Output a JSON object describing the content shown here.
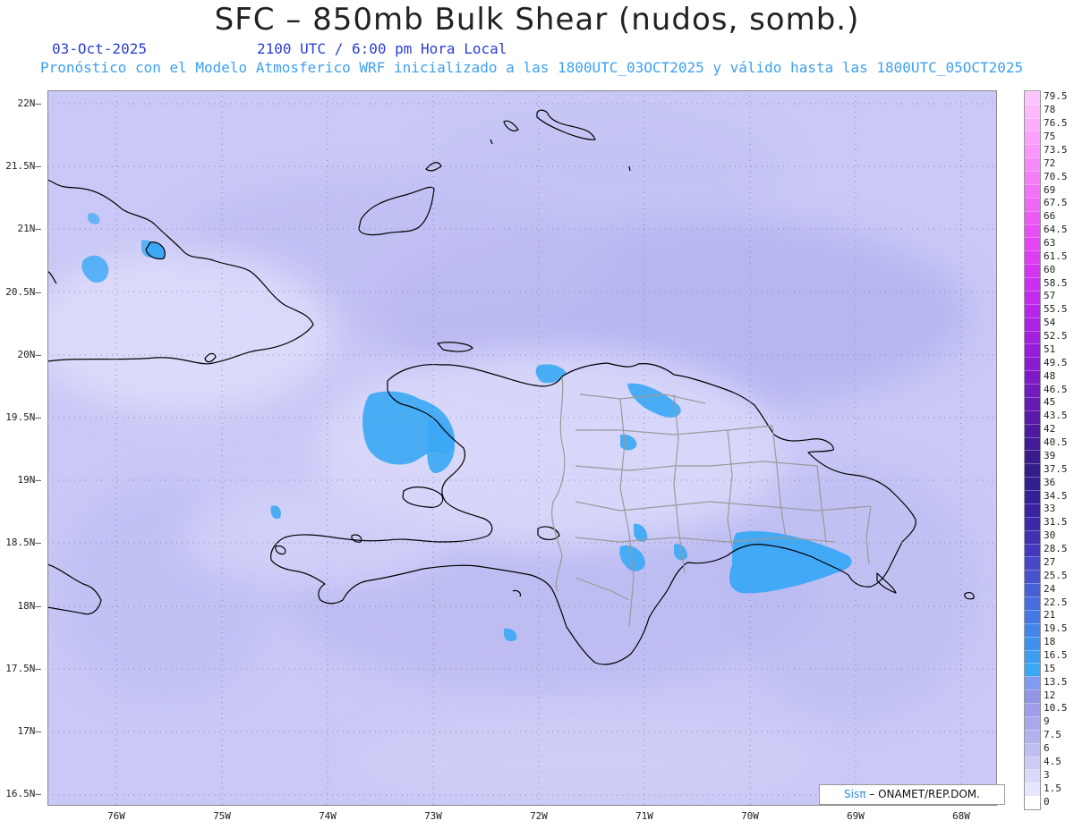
{
  "header": {
    "title": "SFC – 850mb Bulk Shear (nudos, somb.)",
    "date": "03-Oct-2025",
    "time": "2100 UTC / 6:00 pm Hora Local",
    "description": "Pronóstico con el Modelo Atmosferico WRF inicializado a las 1800UTC_03OCT2025 y válido hasta las  1800UTC_05OCT2025"
  },
  "map": {
    "lat_labels": [
      "22N",
      "21.5N",
      "21N",
      "20.5N",
      "20N",
      "19.5N",
      "19N",
      "18.5N",
      "18N",
      "17.5N",
      "17N",
      "16.5N"
    ],
    "lon_labels": [
      "76W",
      "75W",
      "74W",
      "73W",
      "72W",
      "71W",
      "70W",
      "69W",
      "68W"
    ],
    "base_color": "#c9c8f6",
    "coast_color": "#000000",
    "border_color": "#9a9a9a"
  },
  "colorbar": {
    "labels": [
      "0",
      "1.5",
      "3",
      "4.5",
      "6",
      "7.5",
      "9",
      "10.5",
      "12",
      "13.5",
      "15",
      "16.5",
      "18",
      "19.5",
      "21",
      "22.5",
      "24",
      "25.5",
      "27",
      "28.5",
      "30",
      "31.5",
      "33",
      "34.5",
      "36",
      "37.5",
      "39",
      "40.5",
      "42",
      "43.5",
      "45",
      "46.5",
      "48",
      "49.5",
      "51",
      "52.5",
      "54",
      "55.5",
      "57",
      "58.5",
      "60",
      "61.5",
      "63",
      "64.5",
      "66",
      "67.5",
      "69",
      "70.5",
      "72",
      "73.5",
      "75",
      "76.5",
      "78",
      "79.5"
    ],
    "colors": [
      "#ffffff",
      "#e6e6fc",
      "#d9d9fa",
      "#cbcbf6",
      "#bebef2",
      "#b2b2ef",
      "#a8a8ec",
      "#9e9ee9",
      "#9494e6",
      "#7f9bf2",
      "#3aa8f5",
      "#3d9df2",
      "#3f91ee",
      "#4286ea",
      "#4479e4",
      "#466cdd",
      "#4760d6",
      "#4852cf",
      "#4745c8",
      "#4438be",
      "#4230b3",
      "#3d28aa",
      "#3a22a2",
      "#36209a",
      "#331e92",
      "#351c8c",
      "#3a1b8f",
      "#431b96",
      "#4e1aa0",
      "#5a19aa",
      "#6619b5",
      "#7219bf",
      "#7f19c8",
      "#8b1bd0",
      "#971dd8",
      "#a21fdf",
      "#ad22e5",
      "#b826ea",
      "#c32aee",
      "#cc2ff1",
      "#d535f3",
      "#dd3cf4",
      "#e444f5",
      "#e94ef5",
      "#ed5af6",
      "#f066f6",
      "#f372f7",
      "#f57ef8",
      "#f78af9",
      "#f896fa",
      "#f9a1fb",
      "#fbadfc",
      "#fcb9fc",
      "#fdc5fd"
    ]
  },
  "credit": {
    "brand": "Sisπ",
    "text": "– ONAMET/REP.DOM."
  }
}
